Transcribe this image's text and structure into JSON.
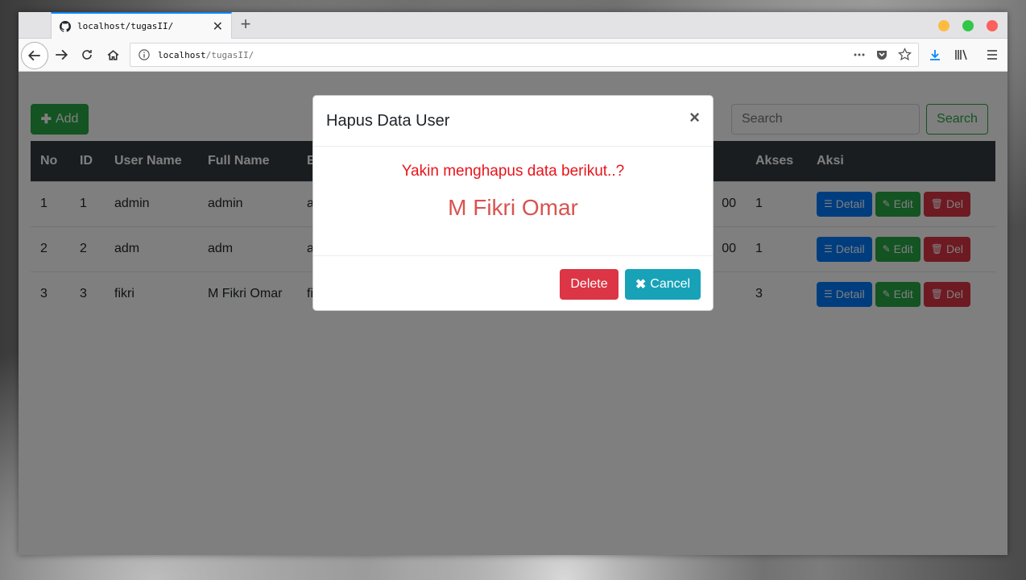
{
  "browser": {
    "tab_title": "localhost/tugasII/",
    "new_tab_symbol": "+",
    "url_host": "localhost",
    "url_path": "/tugasII/"
  },
  "toolbar": {
    "add_label": "Add",
    "search_placeholder": "Search",
    "search_button_label": "Search"
  },
  "table": {
    "headers": [
      "No",
      "ID",
      "User Name",
      "Full Name",
      "E",
      "Akses",
      "Aksi"
    ],
    "rows": [
      {
        "no": "1",
        "id": "1",
        "username": "admin",
        "fullname": "admin",
        "partial_email": "a",
        "partial_col": "00",
        "akses": "1"
      },
      {
        "no": "2",
        "id": "2",
        "username": "adm",
        "fullname": "adm",
        "partial_email": "a",
        "partial_col": "00",
        "akses": "1"
      },
      {
        "no": "3",
        "id": "3",
        "username": "fikri",
        "fullname": "M Fikri Omar",
        "partial_email": "fi",
        "partial_col": "",
        "akses": "3"
      }
    ],
    "actions": {
      "detail": "Detail",
      "edit": "Edit",
      "del": "Del"
    }
  },
  "modal": {
    "title": "Hapus Data User",
    "close_symbol": "×",
    "question": "Yakin menghapus data berikut..?",
    "target_name": "M Fikri Omar",
    "delete_label": "Delete",
    "cancel_label": "Cancel"
  },
  "colors": {
    "success": "#28a745",
    "primary": "#007bff",
    "danger": "#dc3545",
    "info": "#17a2b8",
    "dark": "#343a40"
  }
}
